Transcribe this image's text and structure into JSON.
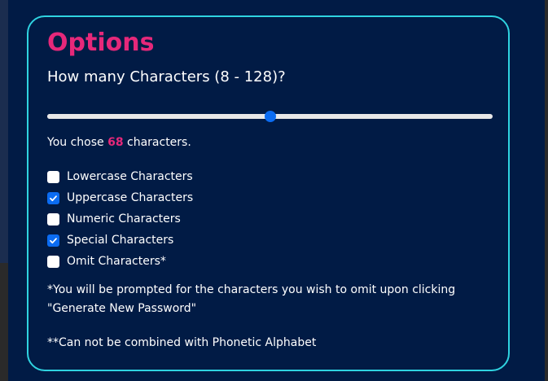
{
  "options": {
    "title": "Options",
    "question": "How many Characters (8 - 128)?",
    "slider": {
      "min": 8,
      "max": 128,
      "value": 68
    },
    "chose_prefix": "You chose ",
    "chose_count": "68",
    "chose_suffix": " characters.",
    "checkboxes": [
      {
        "label": "Lowercase Characters",
        "checked": false
      },
      {
        "label": "Uppercase Characters",
        "checked": true
      },
      {
        "label": "Numeric Characters",
        "checked": false
      },
      {
        "label": "Special Characters",
        "checked": true
      },
      {
        "label": "Omit Characters*",
        "checked": false
      }
    ],
    "note_omit": "*You will be prompted for the characters you wish to omit upon clicking \"Generate New Password\"",
    "note_phonetic": "**Can not be combined with Phonetic Alphabet"
  },
  "colors": {
    "background": "#011b45",
    "accent_pink": "#e6287a",
    "card_border": "#2fd3e0",
    "check_blue": "#0b6cf2"
  }
}
